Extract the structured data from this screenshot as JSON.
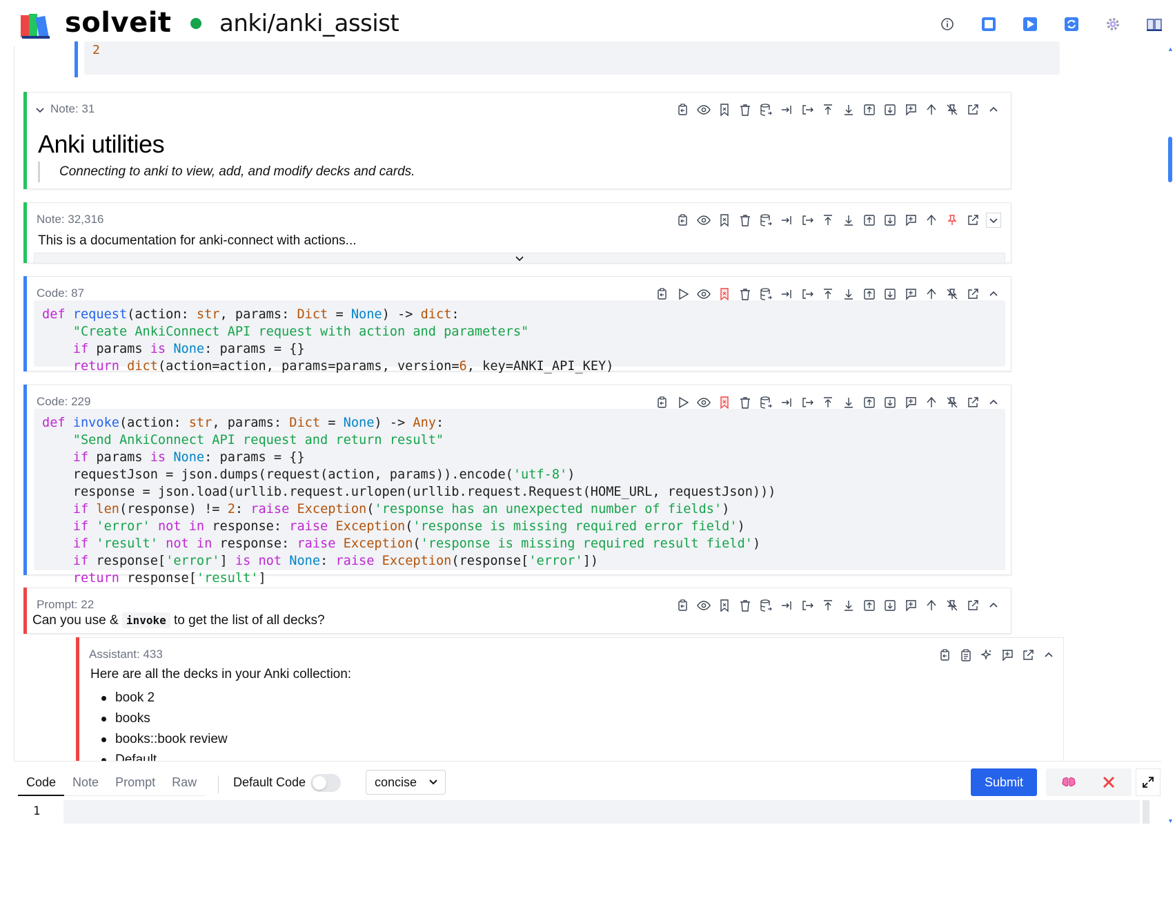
{
  "header": {
    "brand": "solveit",
    "notebook_path": "anki/anki_assist",
    "icons": [
      "info-icon",
      "stop-icon",
      "run-icon",
      "sync-icon",
      "settings-icon",
      "book-icon"
    ]
  },
  "top_output": {
    "value": "2"
  },
  "cells": [
    {
      "label": "Note: 31",
      "heading": "Anki utilities",
      "blockquote": "Connecting to anki to view, add, and modify decks and cards."
    },
    {
      "label": "Note: 32,316",
      "text": "This is a documentation for anki-connect with actions..."
    },
    {
      "label": "Code: 87",
      "code_lines": [
        "def request(action: str, params: Dict = None) -> dict:",
        "    \"Create AnkiConnect API request with action and parameters\"",
        "    if params is None: params = {}",
        "    return dict(action=action, params=params, version=6, key=ANKI_API_KEY)"
      ]
    },
    {
      "label": "Code: 229",
      "code_lines": [
        "def invoke(action: str, params: Dict = None) -> Any:",
        "    \"Send AnkiConnect API request and return result\"",
        "    if params is None: params = {}",
        "    requestJson = json.dumps(request(action, params)).encode('utf-8')",
        "    response = json.load(urllib.request.urlopen(urllib.request.Request(HOME_URL, requestJson)))",
        "    if len(response) != 2: raise Exception('response has an unexpected number of fields')",
        "    if 'error' not in response: raise Exception('response is missing required error field')",
        "    if 'result' not in response: raise Exception('response is missing required result field')",
        "    if response['error'] is not None: raise Exception(response['error'])",
        "    return response['result']"
      ]
    },
    {
      "label": "Prompt: 22",
      "text_before": "Can you use &",
      "inline_code": "invoke",
      "text_after": "to get the list of all decks?"
    },
    {
      "label": "Assistant: 433",
      "intro": "Here are all the decks in your Anki collection:",
      "decks": [
        "book 2",
        "books",
        "books::book review",
        "Default"
      ]
    }
  ],
  "editor": {
    "tabs": [
      "Code",
      "Note",
      "Prompt",
      "Raw"
    ],
    "active_tab": "Code",
    "default_code_label": "Default Code",
    "default_code_on": false,
    "mode_select": "concise",
    "submit_label": "Submit",
    "line_number": "1"
  },
  "colors": {
    "accent_blue": "#2563eb",
    "note_bar": "#22c55e",
    "code_bar": "#3b82f6",
    "prompt_bar": "#ef4444",
    "status_dot": "#16a34a"
  }
}
